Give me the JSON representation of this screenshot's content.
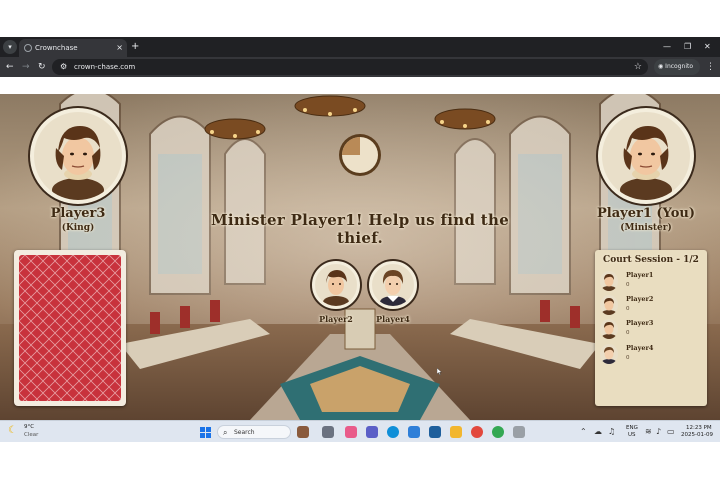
{
  "browser": {
    "tab_title": "Crownchase",
    "tab_close": "×",
    "new_tab": "+",
    "url": "crown-chase.com",
    "incognito_label": "Incognito"
  },
  "game": {
    "headline": "Minister Player1! Help us find the thief.",
    "left_player": {
      "name": "Player3",
      "role": "(King)"
    },
    "right_player": {
      "name": "Player1 (You)",
      "role": "(Minister)"
    },
    "suspects": [
      {
        "name": "Player2"
      },
      {
        "name": "Player4"
      }
    ],
    "timer_remaining_fraction": 0.75,
    "court_session": {
      "title": "Court Session - 1/2",
      "players": [
        {
          "name": "Player1",
          "score": "0"
        },
        {
          "name": "Player2",
          "score": "0"
        },
        {
          "name": "Player3",
          "score": "0"
        },
        {
          "name": "Player4",
          "score": "0"
        }
      ]
    },
    "colors": {
      "card_red": "#c8323c",
      "parchment": "#e9ddc0",
      "ink": "#3e2a14"
    }
  },
  "taskbar": {
    "weather_temp": "9°C",
    "weather_desc": "Clear",
    "search_placeholder": "Search",
    "lang_line1": "ENG",
    "lang_line2": "US",
    "time": "12:23 PM",
    "date": "2025-01-09"
  }
}
